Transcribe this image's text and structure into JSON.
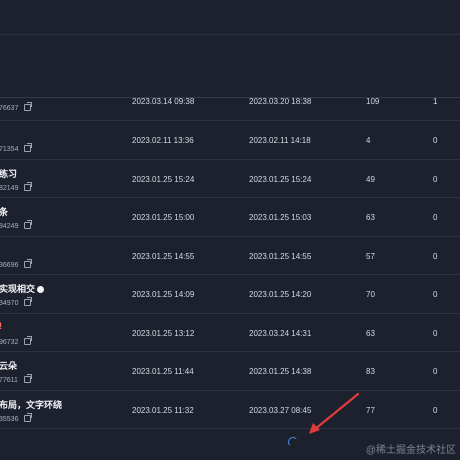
{
  "rows": [
    {
      "title": "",
      "id": "76637",
      "created": "2023.03.14 09:38",
      "updated": "2023.03.20 18:38",
      "views": "109",
      "likes": "1"
    },
    {
      "title": "",
      "id": "71354",
      "created": "2023.02.11 13:36",
      "updated": "2023.02.11 14:18",
      "views": "4",
      "likes": "0"
    },
    {
      "title": "练习",
      "id": "82149",
      "created": "2023.01.25 15:24",
      "updated": "2023.01.25 15:24",
      "views": "49",
      "likes": "0"
    },
    {
      "title": "条",
      "id": "84249",
      "created": "2023.01.25 15:00",
      "updated": "2023.01.25 15:03",
      "views": "63",
      "likes": "0"
    },
    {
      "title": "",
      "id": "36696",
      "created": "2023.01.25 14:55",
      "updated": "2023.01.25 14:55",
      "views": "57",
      "likes": "0"
    },
    {
      "title": "实现相交",
      "id": "34970",
      "created": "2023.01.25 14:09",
      "updated": "2023.01.25 14:20",
      "views": "70",
      "likes": "0"
    },
    {
      "title": "!",
      "id": "96732",
      "created": "2023.01.25 13:12",
      "updated": "2023.03.24 14:31",
      "views": "63",
      "likes": "0"
    },
    {
      "title": "云朵",
      "id": "77611",
      "created": "2023.01.25 11:44",
      "updated": "2023.01.25 14:38",
      "views": "83",
      "likes": "0"
    },
    {
      "title": "布局，文字环绕",
      "id": "35536",
      "created": "2023.01.25 11:32",
      "updated": "2023.03.27 08:45",
      "views": "77",
      "likes": "0"
    }
  ],
  "watermark": "@稀土掘金技术社区",
  "colors": {
    "background": "#1d212d",
    "spinner": "#4c8bf5",
    "arrow": "#e23b3b"
  }
}
